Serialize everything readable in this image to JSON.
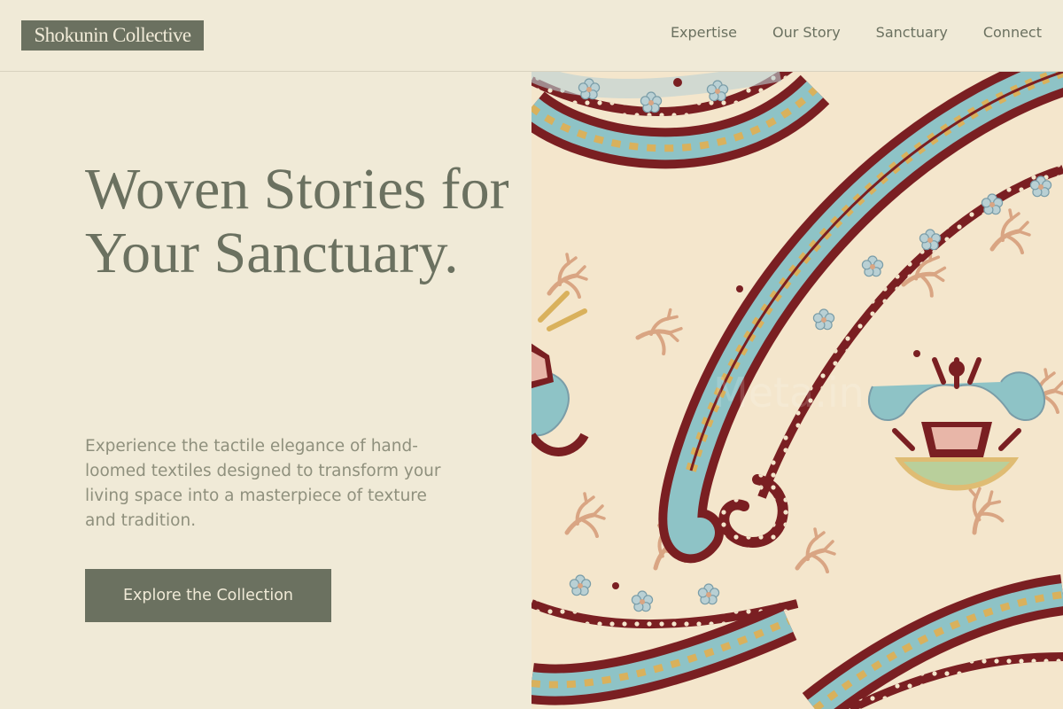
{
  "brand": {
    "name": "Shokunin Collective"
  },
  "nav": {
    "items": [
      {
        "label": "Expertise"
      },
      {
        "label": "Our Story"
      },
      {
        "label": "Sanctuary"
      },
      {
        "label": "Connect"
      }
    ]
  },
  "hero": {
    "title": "Woven Stories for Your Sanctuary.",
    "subtitle": "Experience the tactile elegance of hand-loomed textiles designed to transform your living space into a masterpiece of texture and tradition.",
    "cta_label": "Explore the Collection",
    "image_watermark": "Meta.in"
  },
  "colors": {
    "background": "#f0ead7",
    "primary": "#6b7160",
    "muted_text": "#8f907d",
    "paisley_maroon": "#7a1f22",
    "paisley_teal": "#8ec3c6",
    "paisley_cream": "#f4e6cc",
    "paisley_tan": "#d9a583",
    "paisley_mustard": "#d9b15c"
  },
  "icons": []
}
